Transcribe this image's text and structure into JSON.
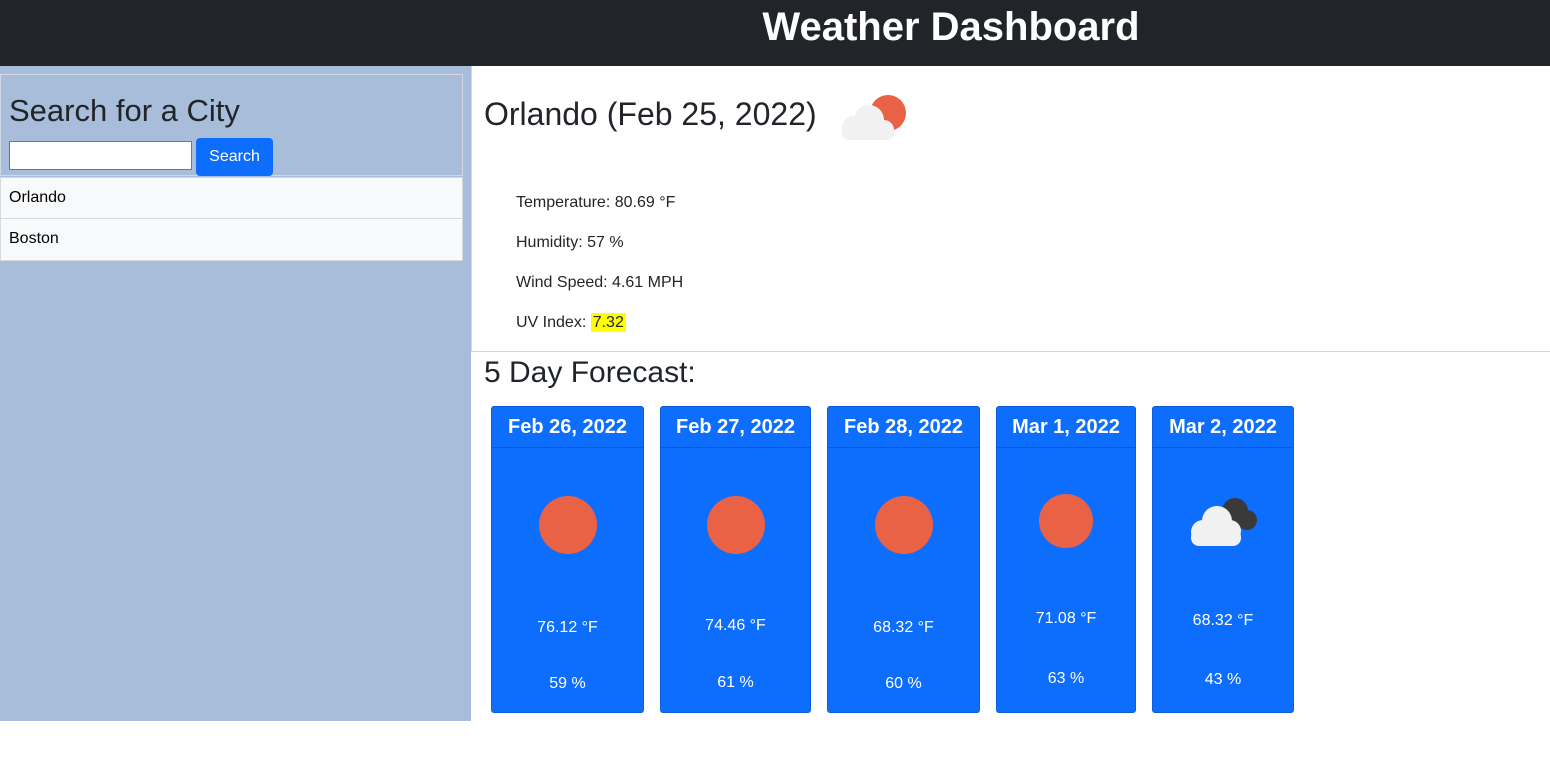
{
  "header": {
    "title": "Weather Dashboard"
  },
  "sidebar": {
    "search_heading": "Search for a City",
    "search_input_value": "",
    "search_button": "Search",
    "history": [
      "Orlando",
      "Boston"
    ]
  },
  "current": {
    "title": "Orlando (Feb 25, 2022)",
    "icon": "sun-behind-cloud-icon",
    "temperature": "Temperature: 80.69 °F",
    "humidity": "Humidity: 57 %",
    "wind": "Wind Speed: 4.61 MPH",
    "uv_label": "UV Index: ",
    "uv_value": "7.32"
  },
  "forecast": {
    "title": "5 Day Forecast:",
    "days": [
      {
        "date": "Feb 26, 2022",
        "icon": "sun-icon",
        "temp": "76.12 °F",
        "humidity": "59 %"
      },
      {
        "date": "Feb 27, 2022",
        "icon": "sun-icon",
        "temp": "74.46 °F",
        "humidity": "61 %"
      },
      {
        "date": "Feb 28, 2022",
        "icon": "sun-icon",
        "temp": "68.32 °F",
        "humidity": "60 %"
      },
      {
        "date": "Mar 1, 2022",
        "icon": "sun-icon",
        "temp": "71.08 °F",
        "humidity": "63 %"
      },
      {
        "date": "Mar 2, 2022",
        "icon": "clouds-icon",
        "temp": "68.32 °F",
        "humidity": "43 %"
      }
    ]
  },
  "colors": {
    "header_bg": "#212529",
    "sidebar_bg": "#a8bdd9",
    "accent": "#0d6efd",
    "uv_highlight": "#ffff00",
    "sun": "#e96245"
  }
}
